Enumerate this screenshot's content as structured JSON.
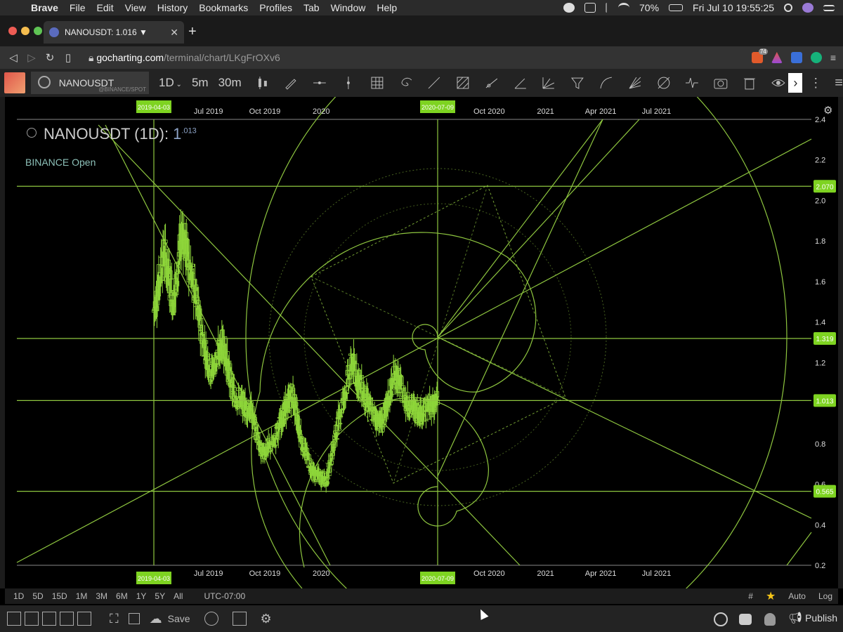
{
  "menubar": {
    "app": "Brave",
    "items": [
      "File",
      "Edit",
      "View",
      "History",
      "Bookmarks",
      "Profiles",
      "Tab",
      "Window",
      "Help"
    ],
    "battery": "70%",
    "clock": "Fri Jul 10  19:55:25"
  },
  "tab": {
    "title": "NANOUSDT: 1.016 ▼"
  },
  "address": {
    "domain": "gocharting.com",
    "path": "/terminal/chart/LKgFrOXv6",
    "badge": "74"
  },
  "toolbar": {
    "symbol": "NANOUSDT",
    "exchange": "@BINANCE/SPOT",
    "interval": "1D",
    "quick_intervals": [
      "5m",
      "30m"
    ]
  },
  "chart_header": {
    "title": "NANOUSDT (1D):",
    "price_main": "1",
    "price_frac": ".013",
    "status": "BINANCE Open"
  },
  "chart_data": {
    "type": "candlestick",
    "title": "NANOUSDT (1D)",
    "x_tick_labels": [
      "Jul 2019",
      "Oct 2019",
      "2020",
      "Oct 2020",
      "2021",
      "Apr 2021",
      "Jul 2021"
    ],
    "x_markers": [
      "2019-04-03",
      "2020-07-09"
    ],
    "y_tick_labels": [
      "2.4",
      "2.2",
      "2.0",
      "1.8",
      "1.6",
      "1.4",
      "1.2",
      "1.0",
      "0.8",
      "0.6",
      "0.4",
      "0.2"
    ],
    "y_range": [
      0.2,
      2.4
    ],
    "horizontal_levels": [
      {
        "value": 2.07,
        "label": "2.070"
      },
      {
        "value": 1.319,
        "label": "1.319"
      },
      {
        "value": 1.013,
        "label": "1.013"
      },
      {
        "value": 0.565,
        "label": "0.565"
      }
    ],
    "price_path": [
      [
        "2019-04-03",
        1.45
      ],
      [
        "2019-04-20",
        1.75
      ],
      [
        "2019-05-05",
        1.5
      ],
      [
        "2019-05-20",
        1.85
      ],
      [
        "2019-06-05",
        1.6
      ],
      [
        "2019-06-20",
        1.35
      ],
      [
        "2019-07-05",
        1.15
      ],
      [
        "2019-07-25",
        1.3
      ],
      [
        "2019-08-10",
        1.05
      ],
      [
        "2019-08-25",
        1.0
      ],
      [
        "2019-09-10",
        0.95
      ],
      [
        "2019-09-25",
        0.75
      ],
      [
        "2019-10-15",
        0.8
      ],
      [
        "2019-11-01",
        0.95
      ],
      [
        "2019-11-15",
        1.05
      ],
      [
        "2019-12-01",
        0.8
      ],
      [
        "2019-12-20",
        0.65
      ],
      [
        "2020-01-10",
        0.62
      ],
      [
        "2020-02-01",
        0.95
      ],
      [
        "2020-02-20",
        1.2
      ],
      [
        "2020-03-10",
        1.05
      ],
      [
        "2020-03-25",
        0.95
      ],
      [
        "2020-04-10",
        0.9
      ],
      [
        "2020-05-01",
        1.15
      ],
      [
        "2020-05-20",
        1.0
      ],
      [
        "2020-06-10",
        0.95
      ],
      [
        "2020-07-09",
        1.013
      ]
    ],
    "grid": false,
    "drawings": "fibonacci spiral, circles, trend lines, dotted polygon"
  },
  "bottom": {
    "ranges": [
      "1D",
      "5D",
      "15D",
      "1M",
      "3M",
      "6M",
      "1Y",
      "5Y",
      "All"
    ],
    "timezone": "UTC-07:00",
    "auto": "Auto",
    "log": "Log",
    "save": "Save",
    "publish": "Publish"
  },
  "colors": {
    "drawing": "#8ec63f",
    "candle": "#8ed63a",
    "label_bg": "#7ed321"
  }
}
